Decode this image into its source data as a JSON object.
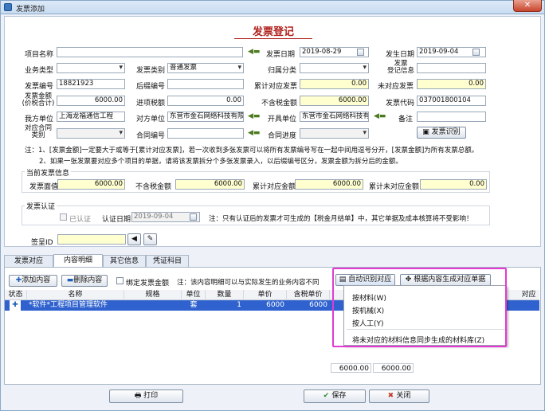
{
  "window": {
    "title": "发票添加",
    "close_label": "✕"
  },
  "form": {
    "heading": "发票登记",
    "project_name": {
      "label": "项目名称",
      "value": ""
    },
    "invoice_date": {
      "label": "发票日期",
      "value": "2019-08-29"
    },
    "occur_date": {
      "label": "发生日期",
      "value": "2019-09-04"
    },
    "business_type": {
      "label": "业务类型",
      "value": ""
    },
    "invoice_category": {
      "label": "发票类别",
      "value": "普通发票"
    },
    "archive_category": {
      "label": "归属分类",
      "value": ""
    },
    "reg_info": {
      "label": "发票\n登记信息",
      "value": ""
    },
    "invoice_no": {
      "label": "发票编号",
      "value": "18821923"
    },
    "post_no": {
      "label": "后缀编号",
      "value": ""
    },
    "acc_invoice": {
      "label": "累计对应发票",
      "value": "0.00"
    },
    "unmatched": {
      "label": "未对应发票",
      "value": "0.00"
    },
    "amount": {
      "label": "发票金额\n(价税合计)",
      "value": "6000.00"
    },
    "input_tax": {
      "label": "进项税额",
      "value": "0.00"
    },
    "amount_ex_tax": {
      "label": "不含税金额",
      "value": "6000.00"
    },
    "invoice_code": {
      "label": "发票代码",
      "value": "037001800104"
    },
    "our_unit": {
      "label": "我方单位",
      "value": "上海龙福通信工程"
    },
    "other_unit": {
      "label": "对方单位",
      "value": "东营市金石网络科技有限"
    },
    "issue_unit": {
      "label": "开具单位",
      "value": "东营市金石网络科技有限"
    },
    "remark": {
      "label": "备注",
      "value": ""
    },
    "contract_type": {
      "label": "对应合同\n类别",
      "value": ""
    },
    "contract_no": {
      "label": "合同编号",
      "value": ""
    },
    "contract_progress": {
      "label": "合同进度",
      "value": ""
    },
    "ocr_button": "发票识别",
    "note1": "注：1、[发票金额]一定要大于或等于[累计对应发票]，若一次收到多张发票可以将所有发票编号写在一起中间用逗号分开，[发票金额]为所有发票总额。",
    "note2": "2、如果一张发票要对应多个项目的单据，请将该发票拆分个多张发票录入，以后缀编号区分，发票金额为拆分后的金额。"
  },
  "current_info": {
    "title": "当前发票信息",
    "face_amount": {
      "label": "发票面值",
      "value": "6000.00"
    },
    "ex_tax": {
      "label": "不含税金额",
      "value": "6000.00"
    },
    "acc_amount": {
      "label": "累计对应金额",
      "value": "6000.00"
    },
    "acc_unmatched": {
      "label": "累计未对应金额",
      "value": "0.00"
    }
  },
  "cert": {
    "title": "发票认证",
    "certified_label": "已认证",
    "cert_date_label": "认证日期",
    "cert_date": "2019-09-04",
    "note": "注：只有认证后的发票才可生成的【税金月结单】中，其它单据及成本核算将不受影响！"
  },
  "sign": {
    "label": "签呈ID",
    "value": ""
  },
  "tabs": [
    "发票对应",
    "内容明细",
    "其它信息",
    "凭证科目"
  ],
  "toolbar": {
    "add": "添加内容",
    "delete": "删除内容",
    "bind_amount": "绑定发票金额",
    "note": "注：该内容明细可以与实际发生的业务内容不同",
    "auto_match": "自动识别对应",
    "generate": "根据内容生成对应单据"
  },
  "grid": {
    "headers": [
      "状态",
      "名称",
      "规格",
      "单位",
      "数量",
      "单价",
      "含税单价",
      "对应"
    ],
    "row": {
      "status": "✚",
      "name": "*软件*工程项目管理软件",
      "spec": "",
      "unit": "套",
      "qty": "1",
      "price": "6000",
      "tax_price": "6000"
    },
    "footer_1": "6000.00",
    "footer_2": "6000.00"
  },
  "menu": {
    "items": [
      "按材料(W)",
      "按机械(X)",
      "按人工(Y)",
      "将未对应的材料信息同步生成的材料库(Z)"
    ]
  },
  "bottom": {
    "print": "打印",
    "save": "保存",
    "close": "关闭"
  },
  "colors": {
    "accent_red": "#b0201b",
    "highlight": "#e23ad2",
    "selected_row": "#2f62cf"
  }
}
